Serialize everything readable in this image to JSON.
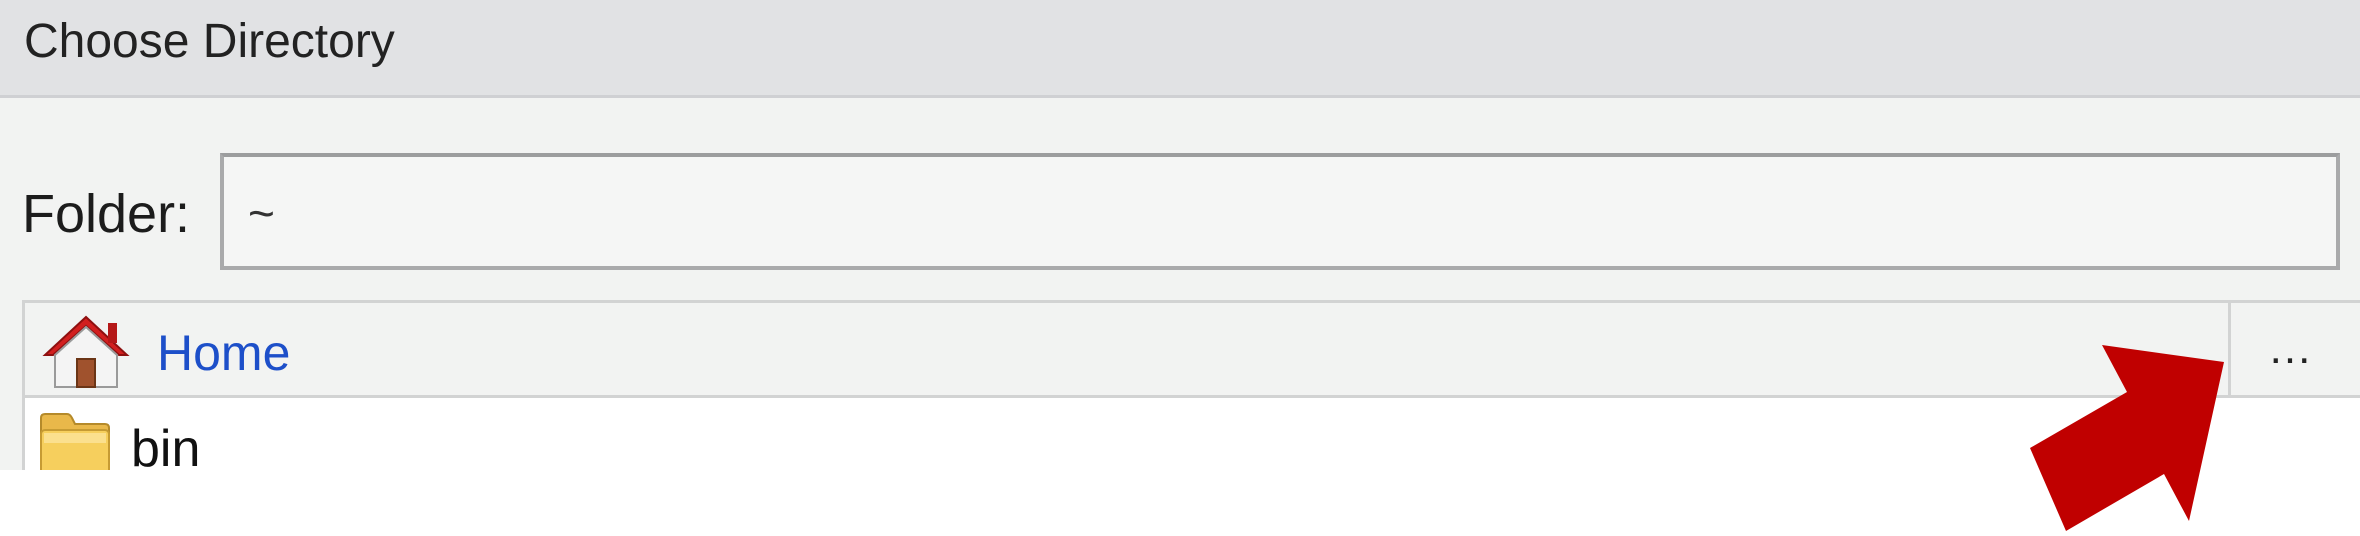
{
  "window": {
    "title": "Choose Directory"
  },
  "folder": {
    "label": "Folder:",
    "value": "~"
  },
  "breadcrumb": {
    "home_label": "Home",
    "more_label": "..."
  },
  "files": [
    {
      "name": "bin",
      "icon": "folder-icon"
    }
  ],
  "colors": {
    "arrow": "#c00000",
    "link": "#1d4fc9",
    "titlebar": "#e1e2e4"
  }
}
